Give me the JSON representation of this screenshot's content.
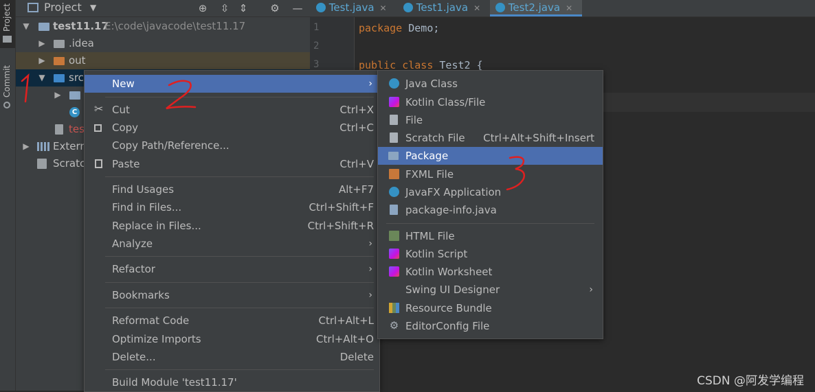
{
  "header": {
    "project_label": "Project",
    "icons": [
      "target-icon",
      "expand-all-icon",
      "collapse-all-icon",
      "gear-icon",
      "minimize-icon"
    ]
  },
  "left_strip": {
    "project_tab": "Project",
    "commit_tab": "Commit"
  },
  "tabs": [
    {
      "label": "Test.java",
      "active": false
    },
    {
      "label": "Test1.java",
      "active": false
    },
    {
      "label": "Test2.java",
      "active": true
    }
  ],
  "tree": {
    "root_name": "test11.17",
    "root_path": "E:\\code\\javacode\\test11.17",
    "idea": ".idea",
    "out": "out",
    "src": "src",
    "iml": "tes",
    "external": "Extern",
    "scratches": "Scratc"
  },
  "editor": {
    "line_numbers": [
      "1",
      "2",
      "3"
    ],
    "line1_kw": "package",
    "line1_rest": " Demo;",
    "line3_kw": "public class",
    "line3_rest": " Test2 {"
  },
  "context_menu": {
    "new": "New",
    "cut": "Cut",
    "cut_sc": "Ctrl+X",
    "copy": "Copy",
    "copy_sc": "Ctrl+C",
    "copy_path": "Copy Path/Reference...",
    "paste": "Paste",
    "paste_sc": "Ctrl+V",
    "find_usages": "Find Usages",
    "find_usages_sc": "Alt+F7",
    "find_in_files": "Find in Files...",
    "find_in_files_sc": "Ctrl+Shift+F",
    "replace_in_files": "Replace in Files...",
    "replace_in_files_sc": "Ctrl+Shift+R",
    "analyze": "Analyze",
    "refactor": "Refactor",
    "bookmarks": "Bookmarks",
    "reformat": "Reformat Code",
    "reformat_sc": "Ctrl+Alt+L",
    "optimize": "Optimize Imports",
    "optimize_sc": "Ctrl+Alt+O",
    "delete": "Delete...",
    "delete_sc": "Delete",
    "build": "Build Module 'test11.17'"
  },
  "new_submenu": {
    "java_class": "Java Class",
    "kotlin_class": "Kotlin Class/File",
    "file": "File",
    "scratch": "Scratch File",
    "scratch_sc": "Ctrl+Alt+Shift+Insert",
    "package": "Package",
    "fxml": "FXML File",
    "javafx": "JavaFX Application",
    "package_info": "package-info.java",
    "html": "HTML File",
    "kotlin_script": "Kotlin Script",
    "kotlin_worksheet": "Kotlin Worksheet",
    "swing": "Swing UI Designer",
    "resource_bundle": "Resource Bundle",
    "editorconfig": "EditorConfig File"
  },
  "watermark": "CSDN @阿发学编程",
  "colors": {
    "selection": "#4b6eaf",
    "annotation": "#e02020",
    "background": "#2b2b2b"
  }
}
